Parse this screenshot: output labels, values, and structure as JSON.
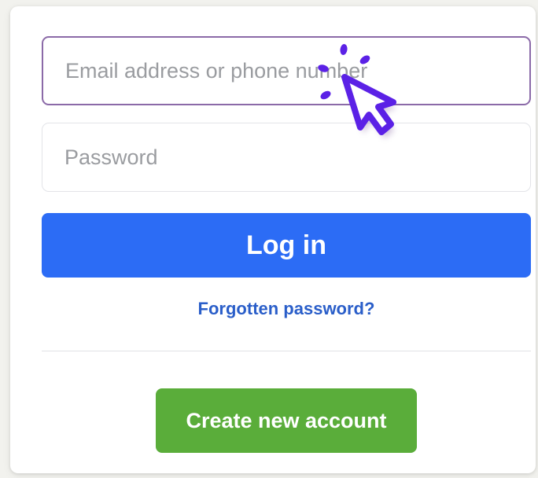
{
  "login_form": {
    "email_placeholder": "Email address or phone number",
    "password_placeholder": "Password",
    "login_label": "Log in",
    "forgot_password_label": "Forgotten password?",
    "create_account_label": "Create new account"
  },
  "colors": {
    "login_button": "#2c6cf5",
    "create_account_button": "#5aad3a",
    "link": "#2a5ec9",
    "cursor_accent": "#5b21e6"
  },
  "icons": {
    "cursor": "click-pointer-icon"
  }
}
